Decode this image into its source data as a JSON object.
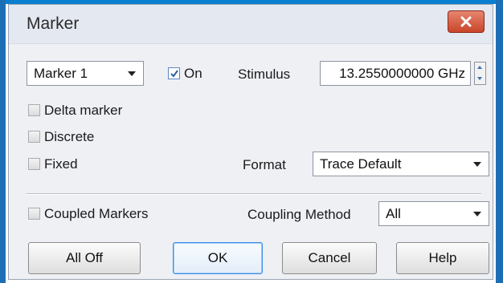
{
  "dialog": {
    "title": "Marker",
    "close_icon": "close-icon"
  },
  "marker_select": {
    "value": "Marker 1"
  },
  "on_checkbox": {
    "label": "On",
    "checked": true
  },
  "stimulus": {
    "label": "Stimulus",
    "value": "13.2550000000 GHz"
  },
  "options": {
    "delta_marker": {
      "label": "Delta marker",
      "checked": false
    },
    "discrete": {
      "label": "Discrete",
      "checked": false
    },
    "fixed": {
      "label": "Fixed",
      "checked": false
    }
  },
  "format": {
    "label": "Format",
    "value": "Trace Default"
  },
  "coupling": {
    "coupled_label": "Coupled Markers",
    "coupled_checked": false,
    "method_label": "Coupling Method",
    "method_value": "All"
  },
  "buttons": {
    "all_off": "All Off",
    "ok": "OK",
    "cancel": "Cancel",
    "help": "Help"
  },
  "colors": {
    "close_button": "#c9452b",
    "accent": "#3c8ee6"
  }
}
